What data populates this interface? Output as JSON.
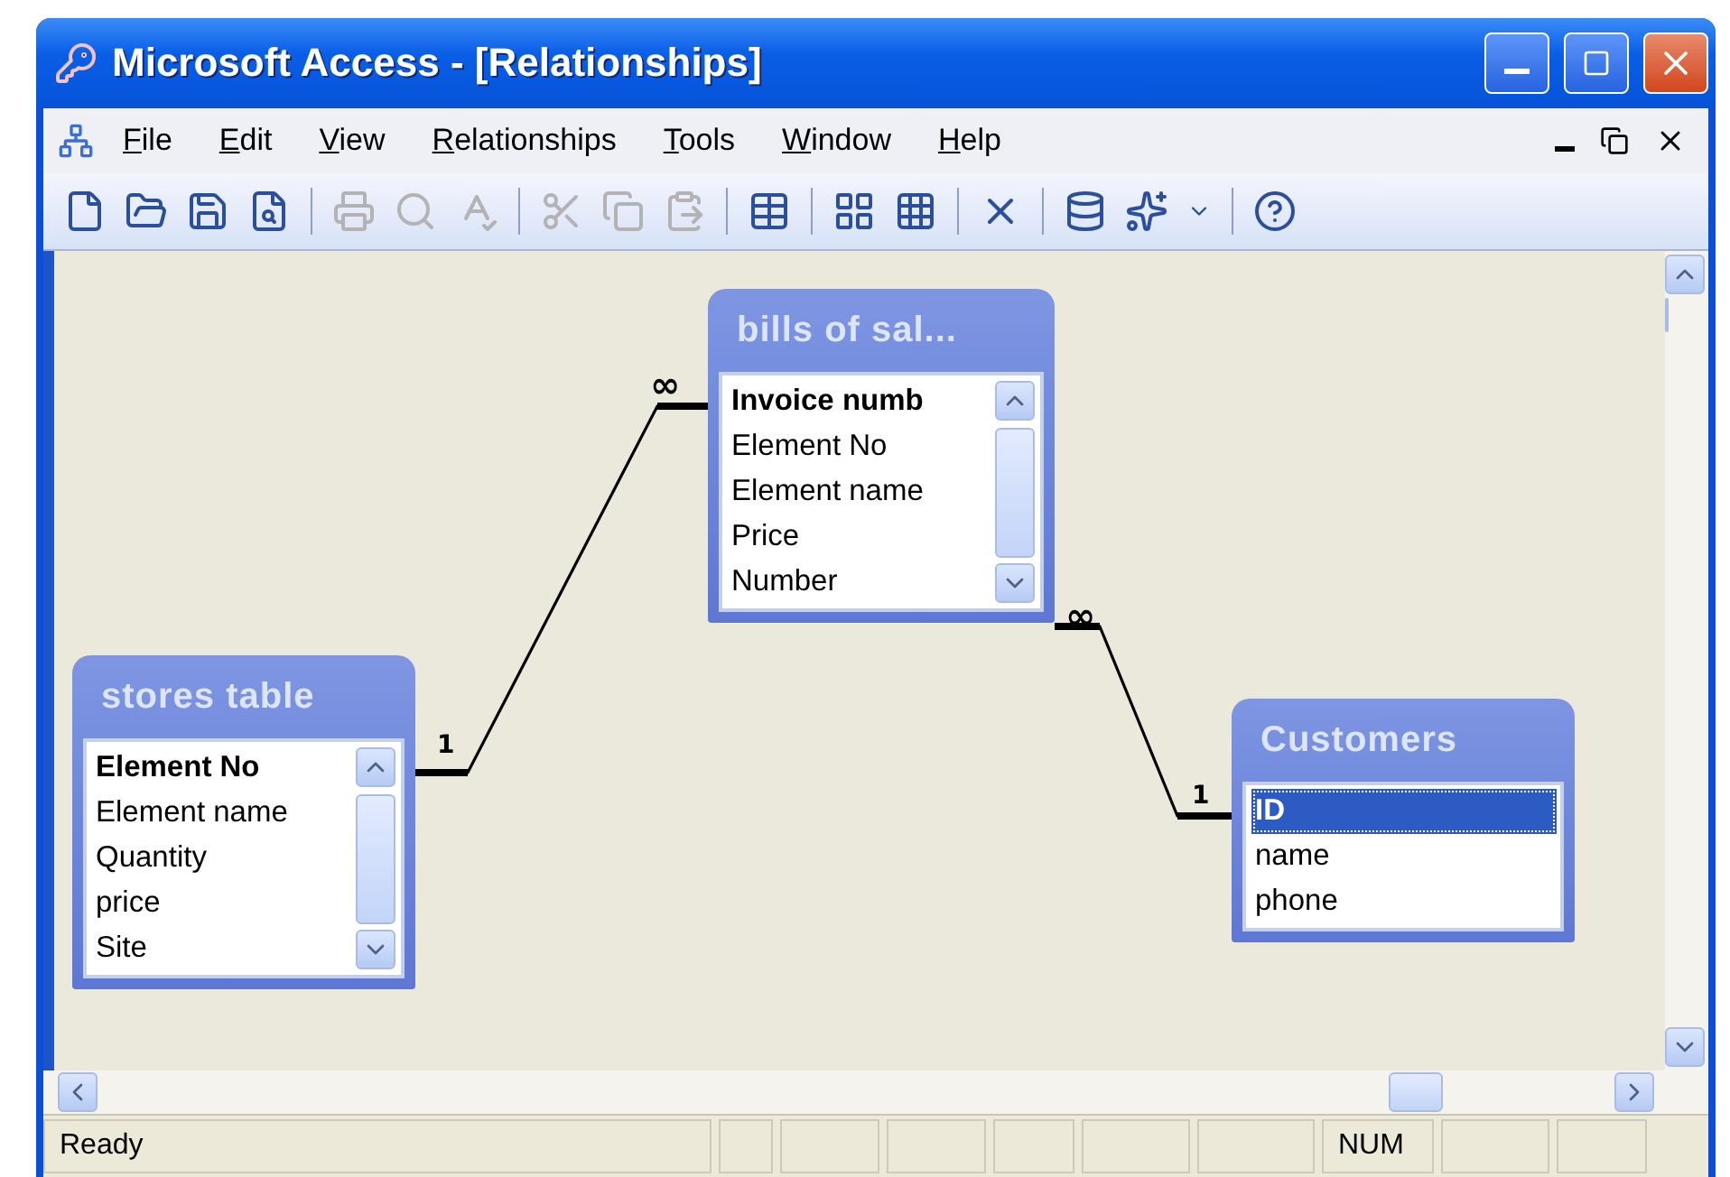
{
  "window": {
    "title": "Microsoft Access - [Relationships]"
  },
  "menu": [
    {
      "label": "File"
    },
    {
      "label": "Edit"
    },
    {
      "label": "View"
    },
    {
      "label": "Relationships"
    },
    {
      "label": "Tools"
    },
    {
      "label": "Window"
    },
    {
      "label": "Help"
    }
  ],
  "toolbar": [
    {
      "kind": "new",
      "disabled": false
    },
    {
      "kind": "open",
      "disabled": false
    },
    {
      "kind": "save",
      "disabled": false
    },
    {
      "kind": "search",
      "disabled": false
    },
    {
      "kind": "separator"
    },
    {
      "kind": "print",
      "disabled": true
    },
    {
      "kind": "preview",
      "disabled": true
    },
    {
      "kind": "spelling",
      "disabled": true
    },
    {
      "kind": "separator"
    },
    {
      "kind": "cut",
      "disabled": true
    },
    {
      "kind": "copy",
      "disabled": true
    },
    {
      "kind": "paste",
      "disabled": true
    },
    {
      "kind": "separator"
    },
    {
      "kind": "show-table",
      "disabled": false
    },
    {
      "kind": "separator"
    },
    {
      "kind": "direct",
      "disabled": false
    },
    {
      "kind": "all",
      "disabled": false
    },
    {
      "kind": "separator"
    },
    {
      "kind": "delete",
      "disabled": false
    },
    {
      "kind": "separator"
    },
    {
      "kind": "database",
      "disabled": false
    },
    {
      "kind": "new-object",
      "disabled": false
    },
    {
      "kind": "dropdown",
      "disabled": false
    },
    {
      "kind": "separator"
    },
    {
      "kind": "help",
      "disabled": false
    }
  ],
  "tables": [
    {
      "title": "bills of sal...",
      "scrollable": true,
      "fields": [
        {
          "name": "Invoice numb",
          "key": true,
          "selected": false
        },
        {
          "name": "Element No",
          "key": false,
          "selected": false
        },
        {
          "name": "Element name",
          "key": false,
          "selected": false
        },
        {
          "name": "Price",
          "key": false,
          "selected": false
        },
        {
          "name": "Number",
          "key": false,
          "selected": false
        }
      ]
    },
    {
      "title": "stores table",
      "scrollable": true,
      "fields": [
        {
          "name": "Element No",
          "key": true,
          "selected": false
        },
        {
          "name": "Element name",
          "key": false,
          "selected": false
        },
        {
          "name": "Quantity",
          "key": false,
          "selected": false
        },
        {
          "name": "price",
          "key": false,
          "selected": false
        },
        {
          "name": "Site",
          "key": false,
          "selected": false
        }
      ]
    },
    {
      "title": "Customers",
      "scrollable": false,
      "fields": [
        {
          "name": "ID",
          "key": true,
          "selected": true
        },
        {
          "name": "name",
          "key": false,
          "selected": false
        },
        {
          "name": "phone",
          "key": false,
          "selected": false
        }
      ]
    }
  ],
  "relationships": [
    {
      "one": "1",
      "many": "∞"
    },
    {
      "one": "1",
      "many": "∞"
    }
  ],
  "status_bar": {
    "message": "Ready",
    "indicator": "NUM"
  }
}
